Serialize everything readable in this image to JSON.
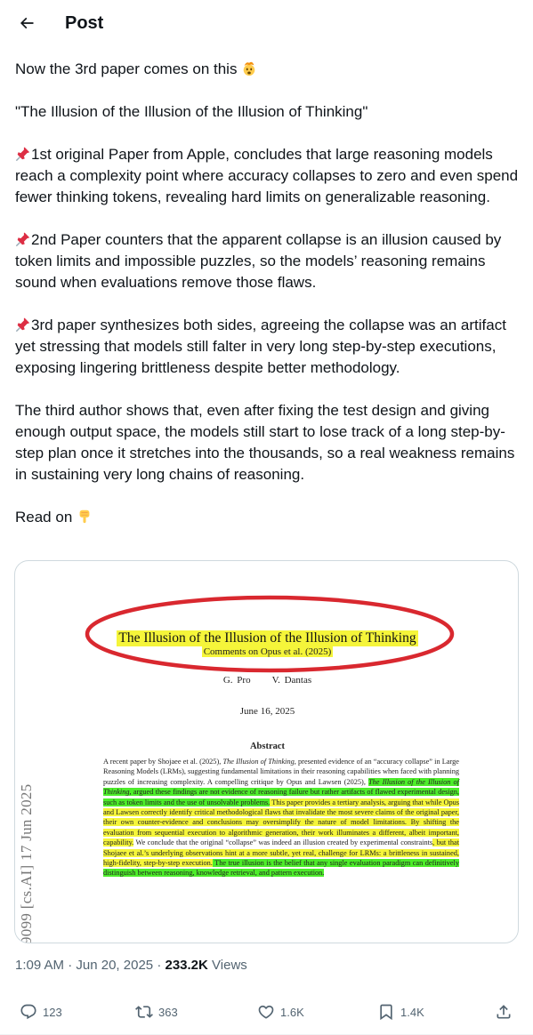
{
  "header": {
    "title": "Post",
    "back_icon": "arrow-left-icon"
  },
  "tweet": {
    "paragraphs": [
      {
        "text": "Now the 3rd paper comes on this",
        "trailing_emoji": "exploding-head-emoji"
      },
      {
        "text": "\"The Illusion of the Illusion of the Illusion of Thinking\""
      },
      {
        "leading_emoji": "pushpin-emoji",
        "text": "1st original Paper from Apple, concludes that large reasoning models reach a complexity point where accuracy collapses to zero and even spend fewer thinking tokens, revealing hard limits on generalizable reasoning."
      },
      {
        "leading_emoji": "pushpin-emoji",
        "text": "2nd Paper counters that the apparent collapse is an illusion caused by token limits and impossible puzzles, so the models’ reasoning remains sound when evaluations remove those flaws."
      },
      {
        "leading_emoji": "pushpin-emoji",
        "text": "3rd paper synthesizes both sides, agreeing the collapse was an artifact yet stressing that models still falter in very long step-by-step executions, exposing lingering brittleness despite better methodology."
      },
      {
        "text": "The third author shows that, even after fixing the test design and giving enough output space, the models still start to lose track of a long step-by-step plan once it stretches into the thousands, so a real weakness remains in sustaining very long chains of reasoning."
      },
      {
        "text": "Read on",
        "trailing_emoji": "backhand-index-pointing-down-emoji"
      }
    ]
  },
  "media": {
    "paper_title": "The Illusion of the Illusion of the Illusion of Thinking",
    "paper_subtitle": "Comments on Opus et al. (2025)",
    "authors": [
      "G. Pro",
      "V. Dantas"
    ],
    "date": "June 16, 2025",
    "abstract_heading": "Abstract",
    "abstract_segments": [
      {
        "text": "A recent paper by Shojaee et al. (2025), ",
        "hl": "none"
      },
      {
        "text": "The Illusion of Thinking",
        "hl": "none",
        "italic": true
      },
      {
        "text": ", presented evidence of an “accuracy collapse” in Large Reasoning Models (LRMs), suggesting fundamental limitations in their reasoning capabilities when faced with planning puzzles of increasing complexity. A compelling critique by Opus and Lawsen (2025), ",
        "hl": "none"
      },
      {
        "text": "The Illusion of the Illusion of Thinking",
        "hl": "green",
        "italic": true
      },
      {
        "text": ", argued these findings are not evidence of reasoning failure but rather artifacts of flawed experimental design, such as token limits and the use of unsolvable problems.",
        "hl": "green"
      },
      {
        "text": " This paper provides a tertiary analysis, arguing that while Opus and Lawsen correctly identify critical methodological flaws that invalidate the most severe claims of the original paper, their own counter-evidence and conclusions may oversimplify the nature of model limitations. By shifting the evaluation from sequential execution to algorithmic generation, their work illuminates a different, albeit important, capability.",
        "hl": "yellow"
      },
      {
        "text": " We conclude that the original “collapse” was indeed an illusion created by experimental constraints",
        "hl": "none"
      },
      {
        "text": ", but that Shojaee et al.’s underlying observations hint at a more subtle, yet real, challenge for LRMs: a brittleness in sustained, high-fidelity, step-by-step execution.",
        "hl": "yellow"
      },
      {
        "text": " The true illusion is the belief that any single evaluation paradigm can definitively distinguish between reasoning, knowledge retrieval, and pattern execution.",
        "hl": "green"
      }
    ],
    "arxiv_stamp": "9099 [cs.AI] 17 Jun 2025",
    "highlight_colors": {
      "yellow": "#f5f53a",
      "green": "#4ded2a",
      "circle": "#d9282f"
    }
  },
  "meta": {
    "time": "1:09 AM",
    "separator": "·",
    "date": "Jun 20, 2025",
    "views_count": "233.2K",
    "views_label": "Views"
  },
  "actions": {
    "reply": {
      "icon": "reply-icon",
      "count": "123"
    },
    "repost": {
      "icon": "repost-icon",
      "count": "363"
    },
    "like": {
      "icon": "heart-icon",
      "count": "1.6K"
    },
    "bookmark": {
      "icon": "bookmark-icon",
      "count": "1.4K"
    },
    "share": {
      "icon": "share-icon"
    }
  },
  "colors": {
    "text": "#0f1419",
    "secondary": "#536471",
    "border": "#cfd9de"
  }
}
